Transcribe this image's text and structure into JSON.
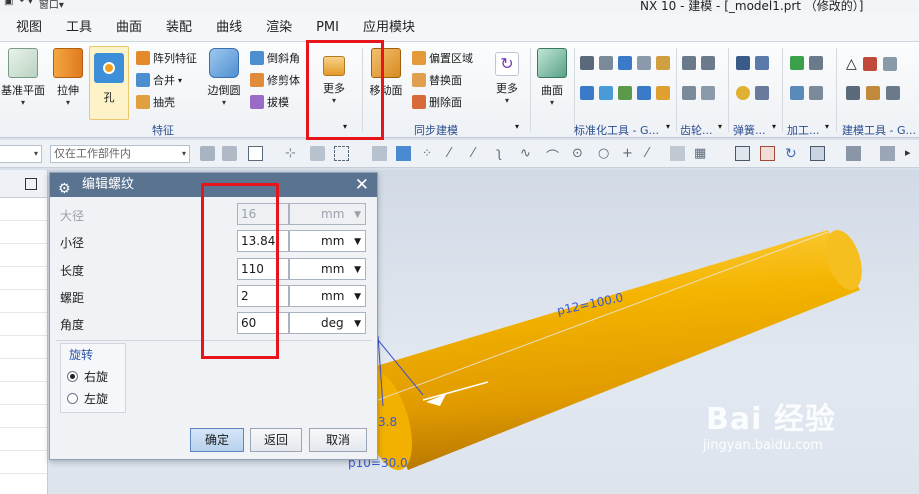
{
  "window": {
    "title": "NX 10 - 建模 - [_model1.prt （修改的）]",
    "quick_access": "窗口"
  },
  "menu": [
    "视图",
    "工具",
    "曲面",
    "装配",
    "曲线",
    "渲染",
    "PMI",
    "应用模块"
  ],
  "ribbon": {
    "feature_group": {
      "label": "特征",
      "datum_plane": "基准平面",
      "extrude": "拉伸",
      "hole": "孔",
      "pattern_feature": "阵列特征",
      "unite": "合并",
      "shell": "抽壳",
      "edge_blend": "边倒圆",
      "chamfer": "倒斜角",
      "trim_body": "修剪体",
      "draft": "拔模",
      "more": "更多"
    },
    "sync_group": {
      "label": "同步建模",
      "move_face": "移动面",
      "offset_region": "偏置区域",
      "replace_face": "替换面",
      "delete_face": "删除面",
      "more": "更多"
    },
    "surface": "曲面",
    "standard_tools_group": "标准化工具 - G...",
    "gear_group": "齿轮...",
    "spring_group": "弹簧...",
    "machining_group": "加工...",
    "modeling_tools_group": "建模工具 - G..."
  },
  "toolbar": {
    "scope_filter": "仅在工作部件内"
  },
  "dialog": {
    "title": "编辑螺纹",
    "fields": [
      {
        "label": "大径",
        "value": "16",
        "unit": "mm",
        "disabled": true
      },
      {
        "label": "小径",
        "value": "13.84",
        "unit": "mm",
        "disabled": false
      },
      {
        "label": "长度",
        "value": "110",
        "unit": "mm",
        "disabled": false
      },
      {
        "label": "螺距",
        "value": "2",
        "unit": "mm",
        "disabled": false
      },
      {
        "label": "角度",
        "value": "60",
        "unit": "deg",
        "disabled": false
      }
    ],
    "rotation": {
      "title": "旋转",
      "right": "右旋",
      "left": "左旋",
      "selected": "right"
    },
    "buttons": {
      "ok": "确定",
      "back": "返回",
      "cancel": "取消"
    }
  },
  "viewport": {
    "dim_length": "p12=100.0",
    "dim_diameter": "p10=30.0",
    "dim_partial": "3.8"
  },
  "watermark": {
    "logo": "Bai 经验",
    "url": "jingyan.baidu.com"
  },
  "colors": {
    "highlight": "#e8141c",
    "cylinder": "#f0a800",
    "dialog_title": "#5a7390"
  }
}
